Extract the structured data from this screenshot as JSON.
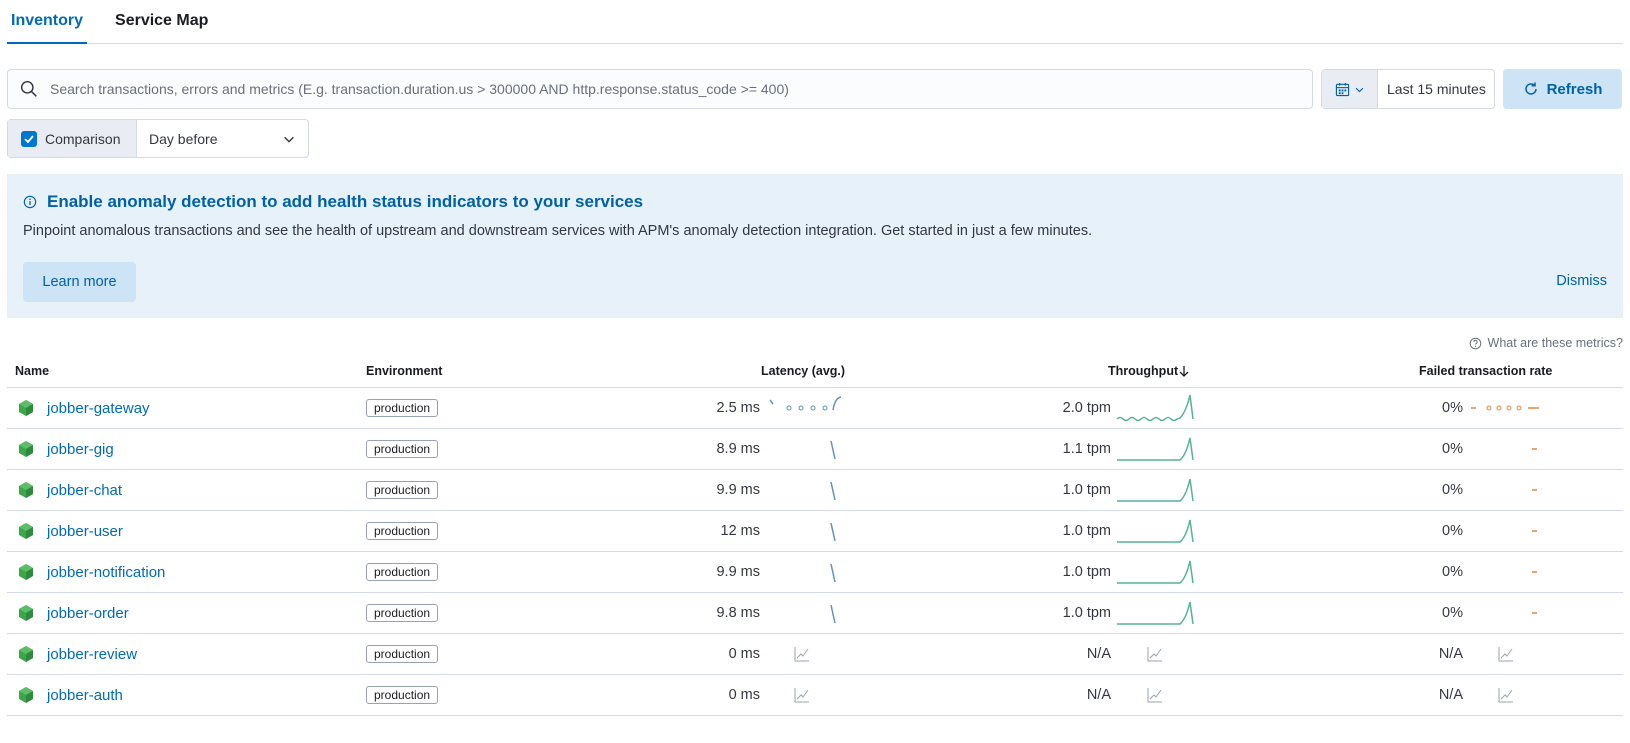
{
  "tabs": [
    {
      "label": "Inventory",
      "active": true
    },
    {
      "label": "Service Map",
      "active": false
    }
  ],
  "search": {
    "placeholder": "Search transactions, errors and metrics (E.g. transaction.duration.us > 300000 AND http.response.status_code >= 400)",
    "value": ""
  },
  "datepicker": {
    "label": "Last 15 minutes",
    "icon": "calendar-icon"
  },
  "refresh": {
    "label": "Refresh",
    "icon": "refresh-icon"
  },
  "comparison": {
    "label": "Comparison",
    "checked": true,
    "selected": "Day before"
  },
  "callout": {
    "title": "Enable anomaly detection to add health status indicators to your services",
    "body": "Pinpoint anomalous transactions and see the health of upstream and downstream services with APM's anomaly detection integration. Get started in just a few minutes.",
    "learn_more": "Learn more",
    "dismiss": "Dismiss"
  },
  "metrics_help": "What are these metrics?",
  "table": {
    "headers": {
      "name": "Name",
      "environment": "Environment",
      "latency": "Latency (avg.)",
      "throughput": "Throughput",
      "failed": "Failed transaction rate"
    },
    "sorted_by": "throughput",
    "sort_direction": "desc",
    "rows": [
      {
        "name": "jobber-gateway",
        "environment": "production",
        "latency": "2.5 ms",
        "throughput": "2.0 tpm",
        "failed": "0%"
      },
      {
        "name": "jobber-gig",
        "environment": "production",
        "latency": "8.9 ms",
        "throughput": "1.1 tpm",
        "failed": "0%"
      },
      {
        "name": "jobber-chat",
        "environment": "production",
        "latency": "9.9 ms",
        "throughput": "1.0 tpm",
        "failed": "0%"
      },
      {
        "name": "jobber-user",
        "environment": "production",
        "latency": "12 ms",
        "throughput": "1.0 tpm",
        "failed": "0%"
      },
      {
        "name": "jobber-notification",
        "environment": "production",
        "latency": "9.9 ms",
        "throughput": "1.0 tpm",
        "failed": "0%"
      },
      {
        "name": "jobber-order",
        "environment": "production",
        "latency": "9.8 ms",
        "throughput": "1.0 tpm",
        "failed": "0%"
      },
      {
        "name": "jobber-review",
        "environment": "production",
        "latency": "0 ms",
        "throughput": "N/A",
        "failed": "N/A"
      },
      {
        "name": "jobber-auth",
        "environment": "production",
        "latency": "0 ms",
        "throughput": "N/A",
        "failed": "N/A"
      }
    ]
  },
  "colors": {
    "primary": "#006bb8",
    "latency_spark": "#6092c0",
    "throughput_spark": "#54b399",
    "failed_spark": "#da8b45",
    "service_icon": "#3ca64a",
    "callout_bg": "#e6f1fa"
  }
}
